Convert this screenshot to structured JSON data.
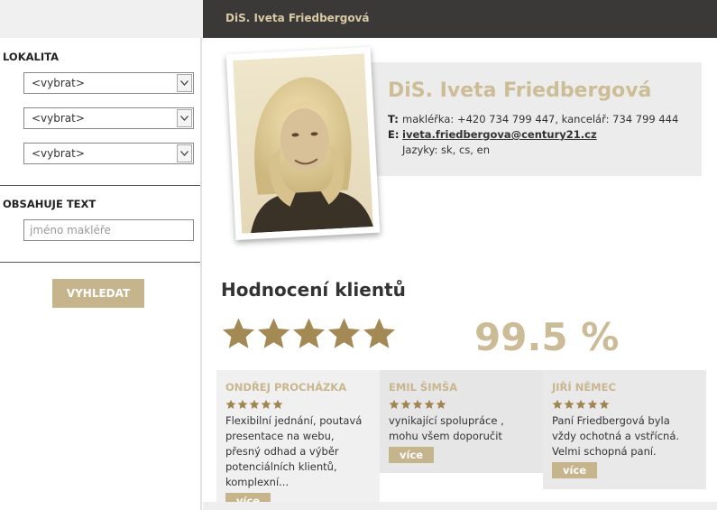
{
  "header": {
    "title": "DiS. Iveta Friedbergová"
  },
  "sidebar": {
    "location_title": "LOKALITA",
    "selects": [
      "<vybrat>",
      "<vybrat>",
      "<vybrat>"
    ],
    "text_title": "OBSAHUJE TEXT",
    "text_placeholder": "jméno makléře",
    "search_label": "VYHLEDAT"
  },
  "profile": {
    "name": "DiS. Iveta Friedbergová",
    "phone_label": "T:",
    "phone_text": "makléřka: +420 734 799 447, kancelář: 734 799 444",
    "email_label": "E:",
    "email": "iveta.friedbergova@century21.cz",
    "languages": "Jazyky: sk, cs, en"
  },
  "ratings": {
    "heading": "Hodnocení klientů",
    "star_count": 5,
    "percent": "99.5 %",
    "reviews": [
      {
        "name": "ONDŘEJ PROCHÁZKA",
        "stars": 5,
        "text": "Flexibilní jednání, poutavá presentace na webu, přesný odhad a výběr potenciálních klientů, komplexní...",
        "more": "více"
      },
      {
        "name": "EMIL ŠIMŠA",
        "stars": 5,
        "text": "vynikající spolupráce , mohu všem doporučit",
        "more": "více"
      },
      {
        "name": "JIŘÍ NĚMEC",
        "stars": 5,
        "text": "Paní Friedbergová byla vždy ochotná a vstřícná. Velmi schopná paní.",
        "more": "více"
      }
    ]
  },
  "colors": {
    "accent": "#c6b48d",
    "dark_bar": "#3a3937",
    "star": "#a08550"
  }
}
